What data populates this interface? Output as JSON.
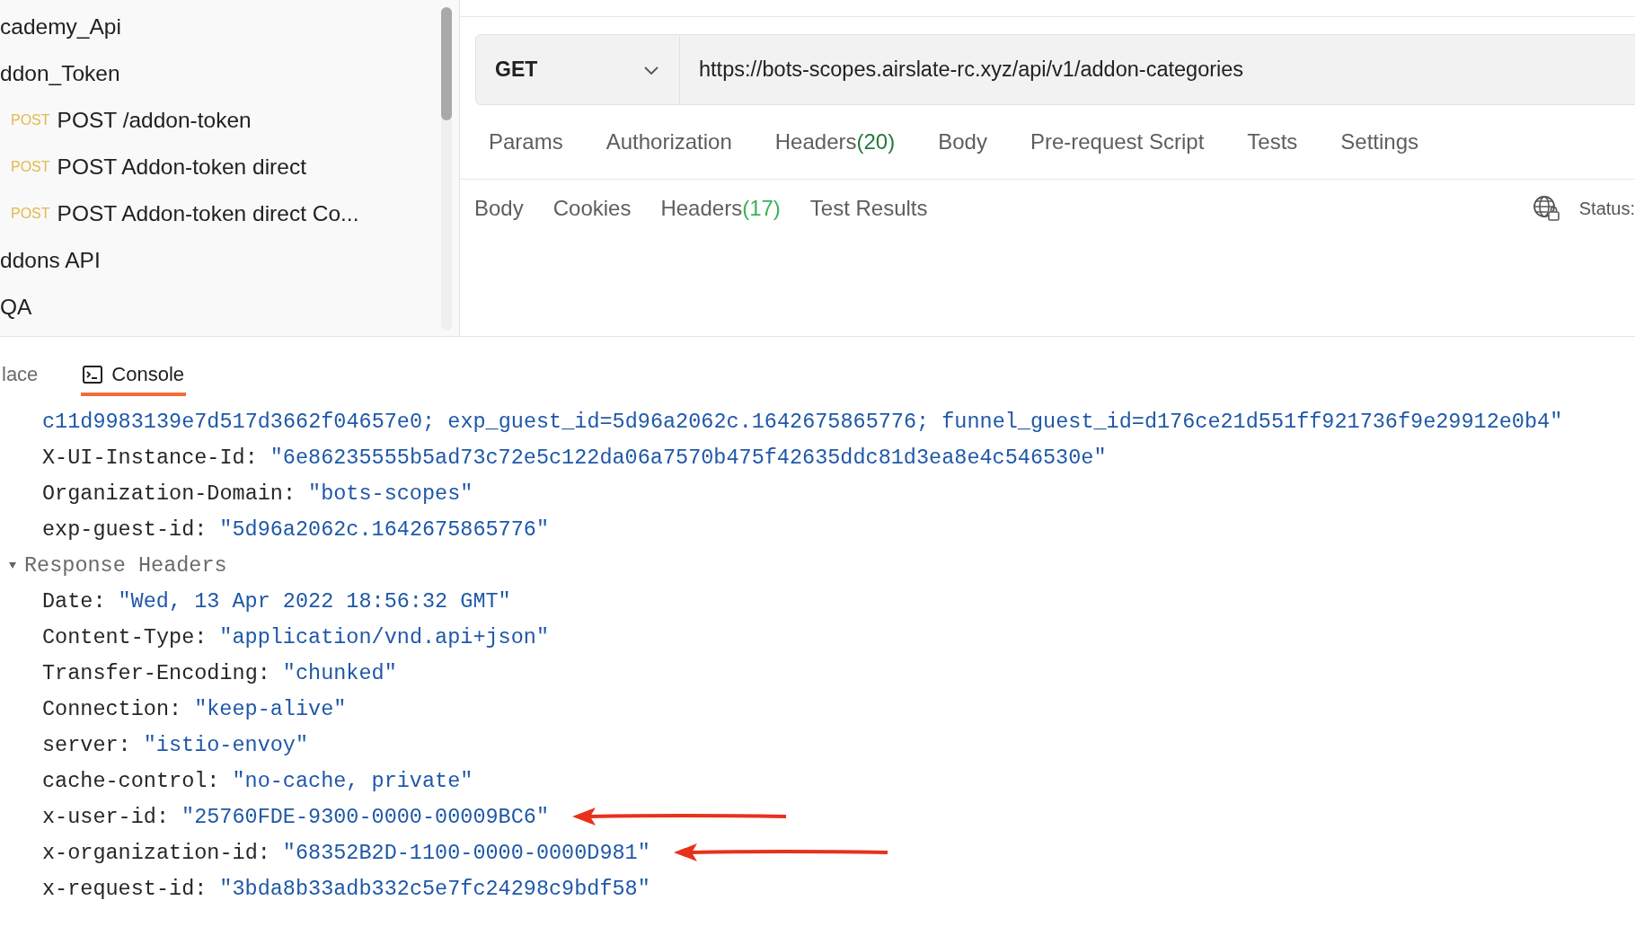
{
  "sidebar": {
    "items": [
      {
        "label": "cademy_Api"
      },
      {
        "label": "ddon_Token",
        "children": [
          {
            "method": "POST",
            "label": "POST /addon-token"
          },
          {
            "method": "POST",
            "label": "POST Addon-token direct"
          },
          {
            "method": "POST",
            "label": "POST Addon-token direct Co..."
          }
        ]
      },
      {
        "label": "ddons API"
      },
      {
        "label": "QA"
      }
    ]
  },
  "request": {
    "method": "GET",
    "url": "https://bots-scopes.airslate-rc.xyz/api/v1/addon-categories",
    "tabs": [
      {
        "label": "Params"
      },
      {
        "label": "Authorization"
      },
      {
        "label": "Headers",
        "count": "(20)"
      },
      {
        "label": "Body"
      },
      {
        "label": "Pre-request Script"
      },
      {
        "label": "Tests"
      },
      {
        "label": "Settings"
      }
    ]
  },
  "response": {
    "tabs": [
      {
        "label": "Body"
      },
      {
        "label": "Cookies"
      },
      {
        "label": "Headers",
        "count": "(17)"
      },
      {
        "label": "Test Results"
      }
    ],
    "status_label": "Status:"
  },
  "bottom_tabs": [
    {
      "label": "lace",
      "selected": false,
      "icon": false
    },
    {
      "label": "Console",
      "selected": true,
      "icon": true
    }
  ],
  "console": {
    "lines": [
      {
        "kind": "value",
        "value": "c11d9983139e7d517d3662f04657e0; exp_guest_id=5d96a2062c.1642675865776; funnel_guest_id=d176ce21d551ff921736f9e29912e0b4\"",
        "marked": false
      },
      {
        "kind": "header",
        "key": "X-UI-Instance-Id:",
        "value": "\"6e86235555b5ad73c72e5c122da06a7570b475f42635ddc81d3ea8e4c546530e\"",
        "marked": false
      },
      {
        "kind": "header",
        "key": "Organization-Domain:",
        "value": "\"bots-scopes\"",
        "marked": false
      },
      {
        "kind": "header",
        "key": "exp-guest-id:",
        "value": "\"5d96a2062c.1642675865776\"",
        "marked": false
      },
      {
        "kind": "section",
        "label": "Response Headers",
        "expanded": true,
        "marked": false
      },
      {
        "kind": "header",
        "key": "Date:",
        "value": "\"Wed, 13 Apr 2022 18:56:32 GMT\"",
        "marked": false
      },
      {
        "kind": "header",
        "key": "Content-Type:",
        "value": "\"application/vnd.api+json\"",
        "marked": false
      },
      {
        "kind": "header",
        "key": "Transfer-Encoding:",
        "value": "\"chunked\"",
        "marked": false
      },
      {
        "kind": "header",
        "key": "Connection:",
        "value": "\"keep-alive\"",
        "marked": false
      },
      {
        "kind": "header",
        "key": "server:",
        "value": "\"istio-envoy\"",
        "marked": false
      },
      {
        "kind": "header",
        "key": "cache-control:",
        "value": "\"no-cache, private\"",
        "marked": false
      },
      {
        "kind": "header",
        "key": "x-user-id:",
        "value": "\"25760FDE-9300-0000-00009BC6\"",
        "marked": true
      },
      {
        "kind": "header",
        "key": "x-organization-id:",
        "value": "\"68352B2D-1100-0000-0000D981\"",
        "marked": true
      },
      {
        "kind": "header",
        "key": "x-request-id:",
        "value": "\"3bda8b33adb332c5e7fc24298c9bdf58\"",
        "marked": false
      }
    ]
  }
}
